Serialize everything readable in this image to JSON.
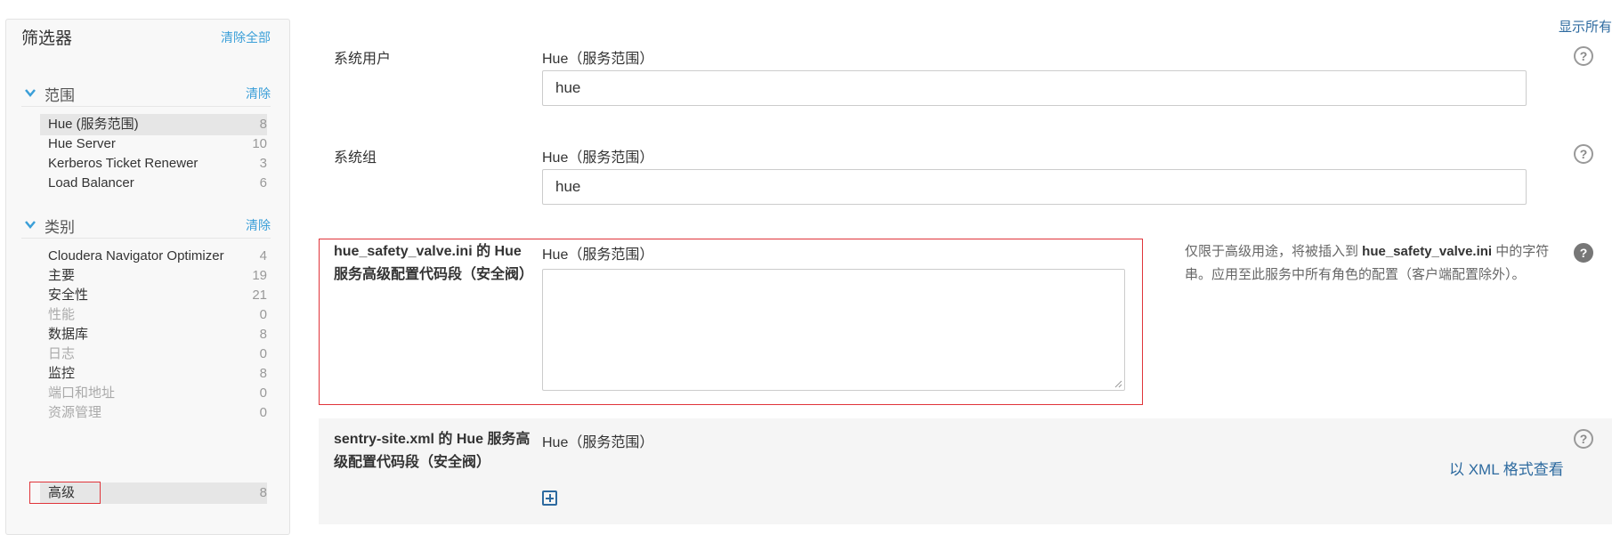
{
  "sidebar": {
    "title": "筛选器",
    "clear_all": "清除全部",
    "scope_section": {
      "title": "范围",
      "clear": "清除",
      "items": [
        {
          "label": "Hue (服务范围)",
          "count": "8"
        },
        {
          "label": "Hue Server",
          "count": "10"
        },
        {
          "label": "Kerberos Ticket Renewer",
          "count": "3"
        },
        {
          "label": "Load Balancer",
          "count": "6"
        }
      ]
    },
    "category_section": {
      "title": "类别",
      "clear": "清除",
      "items": [
        {
          "label": "Cloudera Navigator Optimizer",
          "count": "4"
        },
        {
          "label": "主要",
          "count": "19"
        },
        {
          "label": "安全性",
          "count": "21"
        },
        {
          "label": "性能",
          "count": "0"
        },
        {
          "label": "数据库",
          "count": "8"
        },
        {
          "label": "日志",
          "count": "0"
        },
        {
          "label": "监控",
          "count": "8"
        },
        {
          "label": "端口和地址",
          "count": "0"
        },
        {
          "label": "资源管理",
          "count": "0"
        },
        {
          "label": "高级",
          "count": "8"
        }
      ]
    }
  },
  "header": {
    "show_all": "显示所有"
  },
  "settings": [
    {
      "label": "系统用户",
      "scope": "Hue（服务范围）",
      "value": "hue"
    },
    {
      "label": "系统组",
      "scope": "Hue（服务范围）",
      "value": "hue"
    },
    {
      "label": "hue_safety_valve.ini 的 Hue 服务高级配置代码段（安全阀）",
      "scope": "Hue（服务范围）",
      "value": "",
      "description_pre": "仅限于高级用途，将被插入到 ",
      "description_bold": "hue_safety_valve.ini",
      "description_post": " 中的字符串。应用至此服务中所有角色的配置（客户端配置除外）。"
    },
    {
      "label": "sentry-site.xml 的 Hue 服务高级配置代码段（安全阀）",
      "scope": "Hue（服务范围）",
      "xml_link": "以 XML 格式查看"
    }
  ],
  "icons": {
    "help": "question-circle-icon",
    "chevron": "chevron-down-icon",
    "add": "plus-square-icon"
  },
  "colors": {
    "link": "#3b9fd8",
    "link_dark": "#2d6a9f",
    "highlight_border": "#e0343a",
    "selected_bg": "#e6e6e6"
  }
}
